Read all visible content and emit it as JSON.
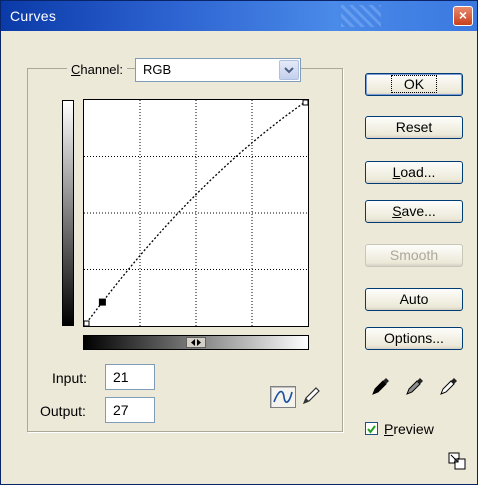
{
  "window": {
    "title": "Curves",
    "close_label": "×"
  },
  "channel": {
    "label_prefix": "",
    "label_mnemonic": "C",
    "label_rest": "hannel:",
    "selected": "RGB"
  },
  "inputs": {
    "input_label": "Input:",
    "input_value": "21",
    "output_label": "Output:",
    "output_value": "27"
  },
  "buttons": {
    "ok": "OK",
    "reset": "Reset",
    "load_mnemonic": "L",
    "load_rest": "oad...",
    "save_mnemonic": "S",
    "save_rest": "ave...",
    "smooth": "Smooth",
    "auto": "Auto",
    "options": "Options..."
  },
  "preview": {
    "checked": true,
    "label_mnemonic": "P",
    "label_rest": "review"
  },
  "curve": {
    "points": [
      [
        0,
        0
      ],
      [
        21,
        27
      ],
      [
        255,
        255
      ]
    ],
    "selected_point": [
      21,
      27
    ]
  },
  "colors": {
    "title_bar": "#2c62d0",
    "dialog_bg": "#ece9d8",
    "button_border": "#003c74"
  }
}
